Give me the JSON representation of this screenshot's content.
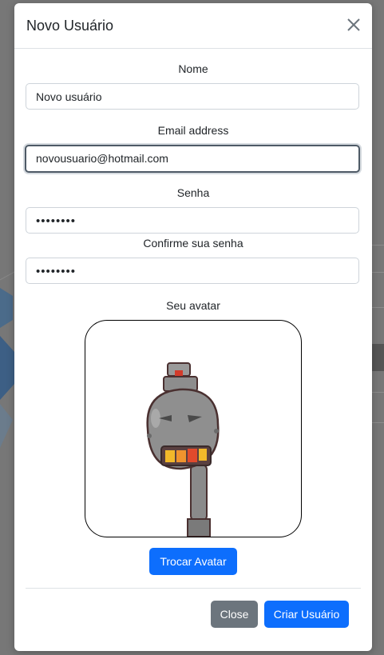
{
  "modal": {
    "title": "Novo Usuário",
    "fields": {
      "name": {
        "label": "Nome",
        "value": "Novo usuário"
      },
      "email": {
        "label": "Email address",
        "value": "novousuario@hotmail.com"
      },
      "password": {
        "label": "Senha",
        "value": "••••••••"
      },
      "confirm": {
        "label": "Confirme sua senha",
        "value": "••••••••"
      }
    },
    "avatar": {
      "label": "Seu avatar"
    },
    "change_avatar_label": "Trocar Avatar",
    "close_label": "Close",
    "create_label": "Criar Usuário"
  },
  "colors": {
    "primary": "#0d6efd",
    "secondary": "#6c757d",
    "backdrop": "#777777"
  },
  "icons": {
    "close": "close-icon"
  }
}
